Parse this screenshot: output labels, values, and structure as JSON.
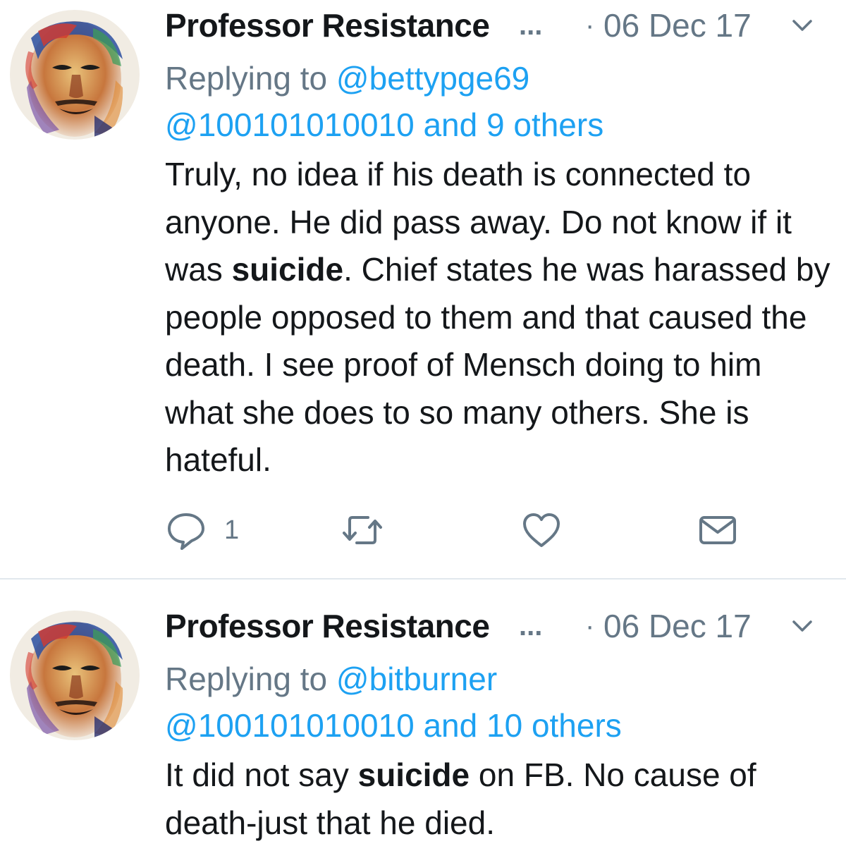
{
  "tweets": [
    {
      "author": "Professor Resistance",
      "truncation": "...",
      "separator": "·",
      "date": "06 Dec 17",
      "menu_icon": "chevron-down-icon",
      "replying_prefix": "Replying to",
      "replying_handle": "@bettypge69",
      "replying_others": "@100101010010 and 9 others",
      "body": [
        {
          "text": "Truly, no idea if his death is connected to anyone. He did pass away. Do not know if it was "
        },
        {
          "text": "suicide",
          "bold": true
        },
        {
          "text": ". Chief states he was harassed by people opposed to them and that caused the death. I see proof of Mensch doing to him what she does to so many others. She is hateful."
        }
      ],
      "actions": {
        "reply_icon": "reply-icon",
        "reply_count": "1",
        "retweet_icon": "retweet-icon",
        "like_icon": "heart-icon",
        "dm_icon": "envelope-icon"
      }
    },
    {
      "author": "Professor Resistance",
      "truncation": "...",
      "separator": "·",
      "date": "06 Dec 17",
      "menu_icon": "chevron-down-icon",
      "replying_prefix": "Replying to",
      "replying_handle": "@bitburner",
      "replying_others": "@100101010010 and 10 others",
      "body": [
        {
          "text": "It did not say "
        },
        {
          "text": "suicide",
          "bold": true
        },
        {
          "text": " on FB. No cause of death-just that he died."
        }
      ]
    }
  ],
  "colors": {
    "text": "#14171a",
    "secondary": "#657786",
    "link": "#1da1f2",
    "divider": "#e1e8ed"
  }
}
